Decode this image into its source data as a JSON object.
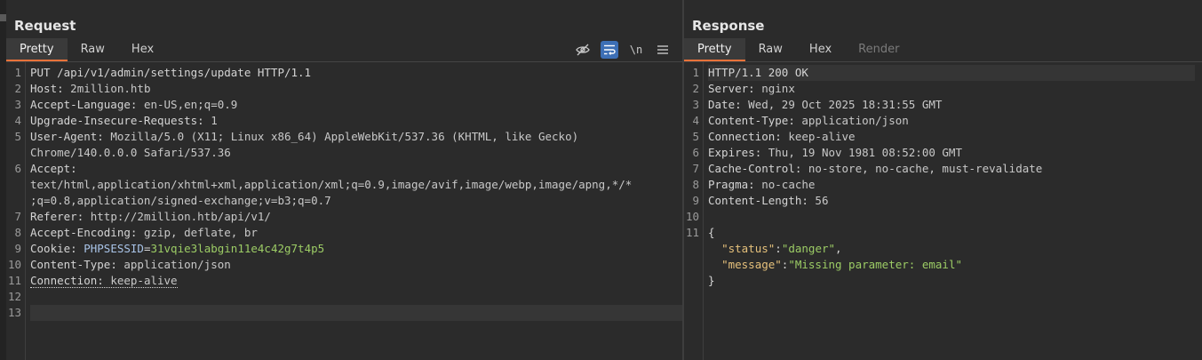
{
  "request": {
    "title": "Request",
    "tabs": [
      "Pretty",
      "Raw",
      "Hex"
    ],
    "tools": [
      "eye-off",
      "wrap",
      "\\n",
      "menu"
    ],
    "lines": [
      {
        "n": "1",
        "k": "PUT /api/v1/admin/settings/update HTTP/1.1",
        "v": ""
      },
      {
        "n": "2",
        "k": "Host",
        "v": " 2million.htb"
      },
      {
        "n": "3",
        "k": "Accept-Language",
        "v": " en-US,en;q=0.9"
      },
      {
        "n": "4",
        "k": "Upgrade-Insecure-Requests",
        "v": " 1"
      },
      {
        "n": "5",
        "k": "User-Agent",
        "v": " Mozilla/5.0 (X11; Linux x86_64) AppleWebKit/537.36 (KHTML, like Gecko)"
      },
      {
        "n": "",
        "k": "",
        "v": "Chrome/140.0.0.0 Safari/537.36"
      },
      {
        "n": "6",
        "k": "Accept",
        "v": ""
      },
      {
        "n": "",
        "k": "",
        "v": "text/html,application/xhtml+xml,application/xml;q=0.9,image/avif,image/webp,image/apng,*/*"
      },
      {
        "n": "",
        "k": "",
        "v": ";q=0.8,application/signed-exchange;v=b3;q=0.7"
      },
      {
        "n": "7",
        "k": "Referer",
        "v": " http://2million.htb/api/v1/"
      },
      {
        "n": "8",
        "k": "Accept-Encoding",
        "v": " gzip, deflate, br"
      },
      {
        "n": "9",
        "k": "Cookie",
        "v": " "
      },
      {
        "n": "10",
        "k": "Content-Type",
        "v": " application/json"
      },
      {
        "n": "11",
        "k": "Connection",
        "v": " keep-alive"
      },
      {
        "n": "12",
        "k": "",
        "v": ""
      },
      {
        "n": "13",
        "k": "",
        "v": ""
      }
    ],
    "cookie_name": "PHPSESSID",
    "cookie_value": "31vqie3labgin11e4c42g7t4p5"
  },
  "response": {
    "title": "Response",
    "tabs": [
      "Pretty",
      "Raw",
      "Hex",
      "Render"
    ],
    "lines": [
      {
        "n": "1",
        "k": "HTTP/1.1 200 OK",
        "v": ""
      },
      {
        "n": "2",
        "k": "Server",
        "v": " nginx"
      },
      {
        "n": "3",
        "k": "Date",
        "v": " Wed, 29 Oct 2025 18:31:55 GMT"
      },
      {
        "n": "4",
        "k": "Content-Type",
        "v": " application/json"
      },
      {
        "n": "5",
        "k": "Connection",
        "v": " keep-alive"
      },
      {
        "n": "6",
        "k": "Expires",
        "v": " Thu, 19 Nov 1981 08:52:00 GMT"
      },
      {
        "n": "7",
        "k": "Cache-Control",
        "v": " no-store, no-cache, must-revalidate"
      },
      {
        "n": "8",
        "k": "Pragma",
        "v": " no-cache"
      },
      {
        "n": "9",
        "k": "Content-Length",
        "v": " 56"
      },
      {
        "n": "10",
        "k": "",
        "v": ""
      },
      {
        "n": "11",
        "k": "",
        "v": "{"
      }
    ],
    "json_body": [
      {
        "key": "\"status\"",
        "value": "\"danger\"",
        "trail": ","
      },
      {
        "key": "\"message\"",
        "value": "\"Missing parameter: email\"",
        "trail": ""
      }
    ],
    "json_close": "}"
  },
  "colors": {
    "accent": "#e8723a",
    "toggle_on": "#3d6fb5",
    "json_key": "#e5c07b",
    "json_string": "#9ccc65"
  }
}
